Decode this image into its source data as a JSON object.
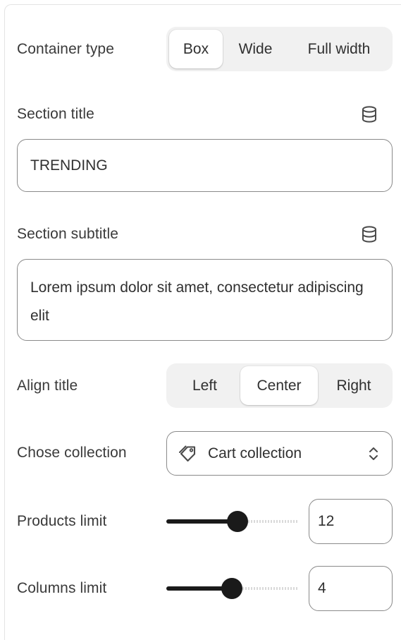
{
  "container_type": {
    "label": "Container type",
    "options": [
      "Box",
      "Wide",
      "Full width"
    ],
    "selected": "Box"
  },
  "section_title": {
    "label": "Section title",
    "value": "TRENDING",
    "icon": "database-icon"
  },
  "section_subtitle": {
    "label": "Section subtitle",
    "value": "Lorem ipsum dolor sit amet, consectetur adipiscing elit",
    "icon": "database-icon"
  },
  "align_title": {
    "label": "Align title",
    "options": [
      "Left",
      "Center",
      "Right"
    ],
    "selected": "Center"
  },
  "collection": {
    "label": "Chose collection",
    "value": "Cart collection",
    "icon": "tag-icon",
    "chevron_icon": "select-chevrons-icon"
  },
  "products_limit": {
    "label": "Products limit",
    "value": "12",
    "slider_fraction": 0.55
  },
  "columns_limit": {
    "label": "Columns limit",
    "value": "4",
    "slider_fraction": 0.5
  },
  "colors": {
    "border": "#8a8a8a",
    "segment_bg": "#f1f1f1",
    "slider": "#1a1a1a"
  }
}
